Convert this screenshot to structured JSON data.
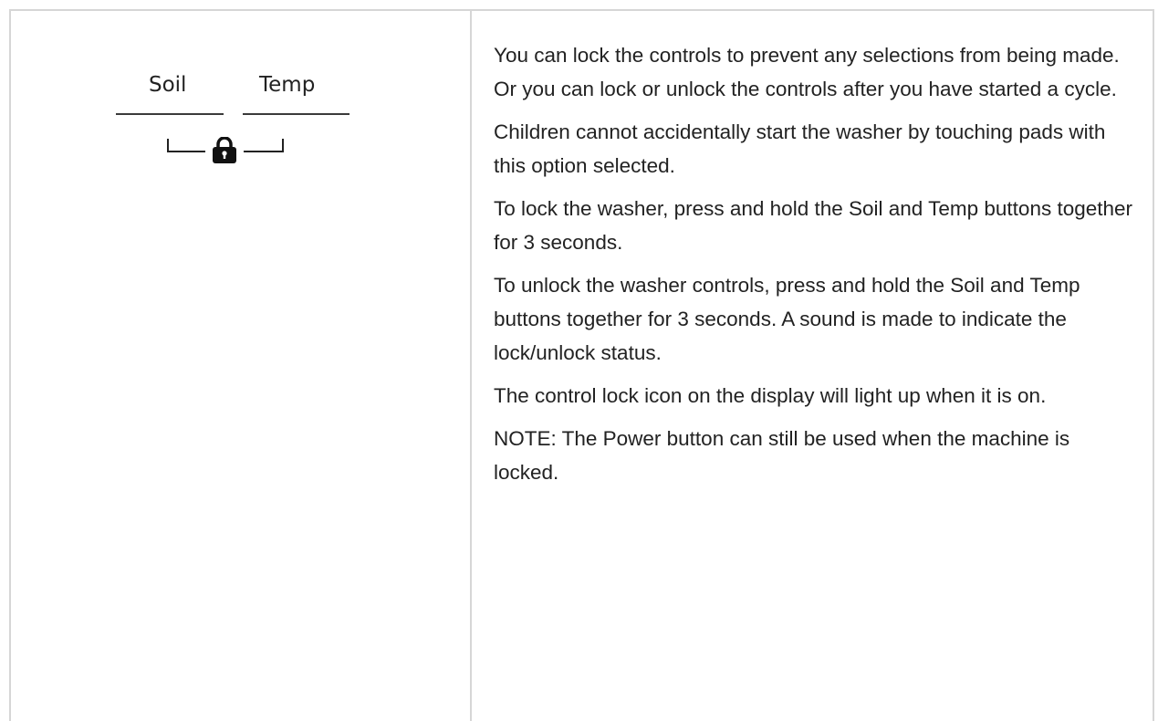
{
  "illustration": {
    "soil_label": "Soil",
    "temp_label": "Temp",
    "lock_icon": "lock-icon"
  },
  "paragraphs": [
    "You can lock the controls to prevent any selections from being made. Or you can lock or unlock the controls after you have started a cycle.",
    "Children cannot accidentally start the washer by touching pads with this option selected.",
    "To lock the washer, press and hold the Soil and Temp buttons together for 3 seconds.",
    "To unlock the washer controls, press and hold the Soil and Temp buttons together for 3 seconds. A sound is made to indicate the lock/unlock status.",
    "The control lock icon on the display will light up when it is on.",
    "NOTE: The Power button can still be used when the machine is locked."
  ]
}
